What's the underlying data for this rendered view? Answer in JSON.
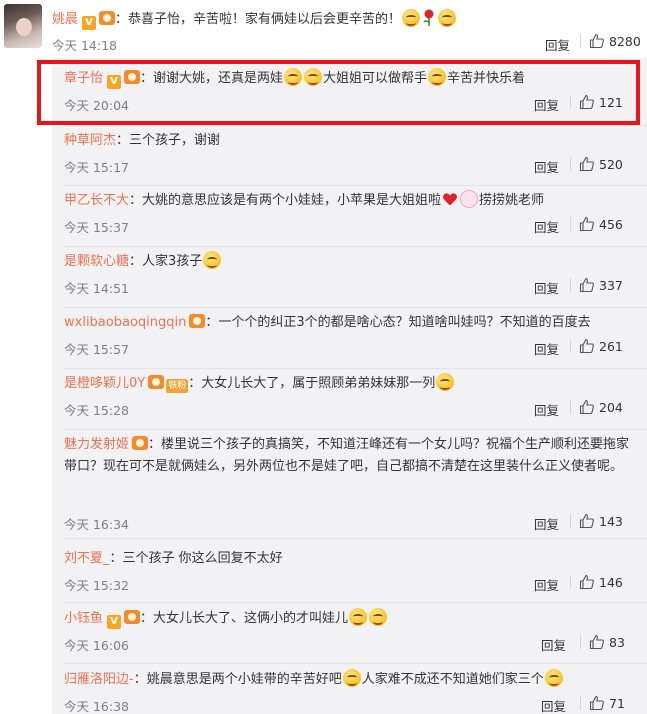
{
  "top_comment": {
    "name": "姚晨",
    "text_before": "：恭喜子怡，辛苦啦！家有俩娃以后会更辛苦的！",
    "time": "今天 14:18",
    "reply_label": "回复",
    "likes": "8280"
  },
  "replies": [
    {
      "name": "章子怡",
      "text": "：谢谢大姚，还真是两娃",
      "text2": "大姐姐可以做帮手",
      "text3": "辛苦并快乐着",
      "time": "今天 20:04",
      "reply_label": "回复",
      "likes": "121"
    },
    {
      "name": "种草阿杰",
      "text": "：三个孩子，谢谢",
      "time": "今天 15:17",
      "reply_label": "回复",
      "likes": "520"
    },
    {
      "name": "甲乙长不大",
      "text": "：大姚的意思应该是有两个小娃娃，小苹果是大姐姐啦",
      "text2": "捞捞姚老师",
      "time": "今天 15:37",
      "reply_label": "回复",
      "likes": "456"
    },
    {
      "name": "是颗软心糖",
      "text": "：人家3孩子",
      "time": "今天 14:51",
      "reply_label": "回复",
      "likes": "337"
    },
    {
      "name": "wxlibaobaoqingqin",
      "text": "：一个个的纠正3个的都是啥心态？知道啥叫娃吗？不知道的百度去",
      "time": "今天 15:57",
      "reply_label": "回复",
      "likes": "261"
    },
    {
      "name": "是橙哆颖儿0Y",
      "badge": "铁粉",
      "text": "：大女儿长大了，属于照顾弟弟妹妹那一列",
      "time": "今天 15:28",
      "reply_label": "回复",
      "likes": "204"
    },
    {
      "name": "魅力发射姬",
      "text": "：楼里说三个孩子的真搞笑，不知道汪峰还有一个女儿吗？祝福个生产顺利还要拖家带口？现在可不是就俩娃么，另外两位也不是娃了吧，自己都搞不清楚在这里装什么正义使者呢。",
      "time": "今天 16:34",
      "reply_label": "回复",
      "likes": "143"
    },
    {
      "name": "刘不夏_",
      "text": "：三个孩子 你这么回复不太好",
      "time": "今天 15:32",
      "reply_label": "回复",
      "likes": "146"
    },
    {
      "name": "小钰鱼",
      "text": "：大女儿长大了、这俩小的才叫娃儿",
      "time": "今天 16:06",
      "reply_label": "回复",
      "likes": "83"
    },
    {
      "name": "归雁洛阳边-",
      "text": "：姚晨意思是两个小娃带的辛苦好吧",
      "text2": "人家难不成还不知道她们家三个",
      "time": "今天 16:38",
      "reply_label": "回复",
      "likes": "71"
    }
  ],
  "colors": {
    "name": "#eb7350",
    "highlight": "#e8141c",
    "reply_bg": "#f2f2f5"
  }
}
